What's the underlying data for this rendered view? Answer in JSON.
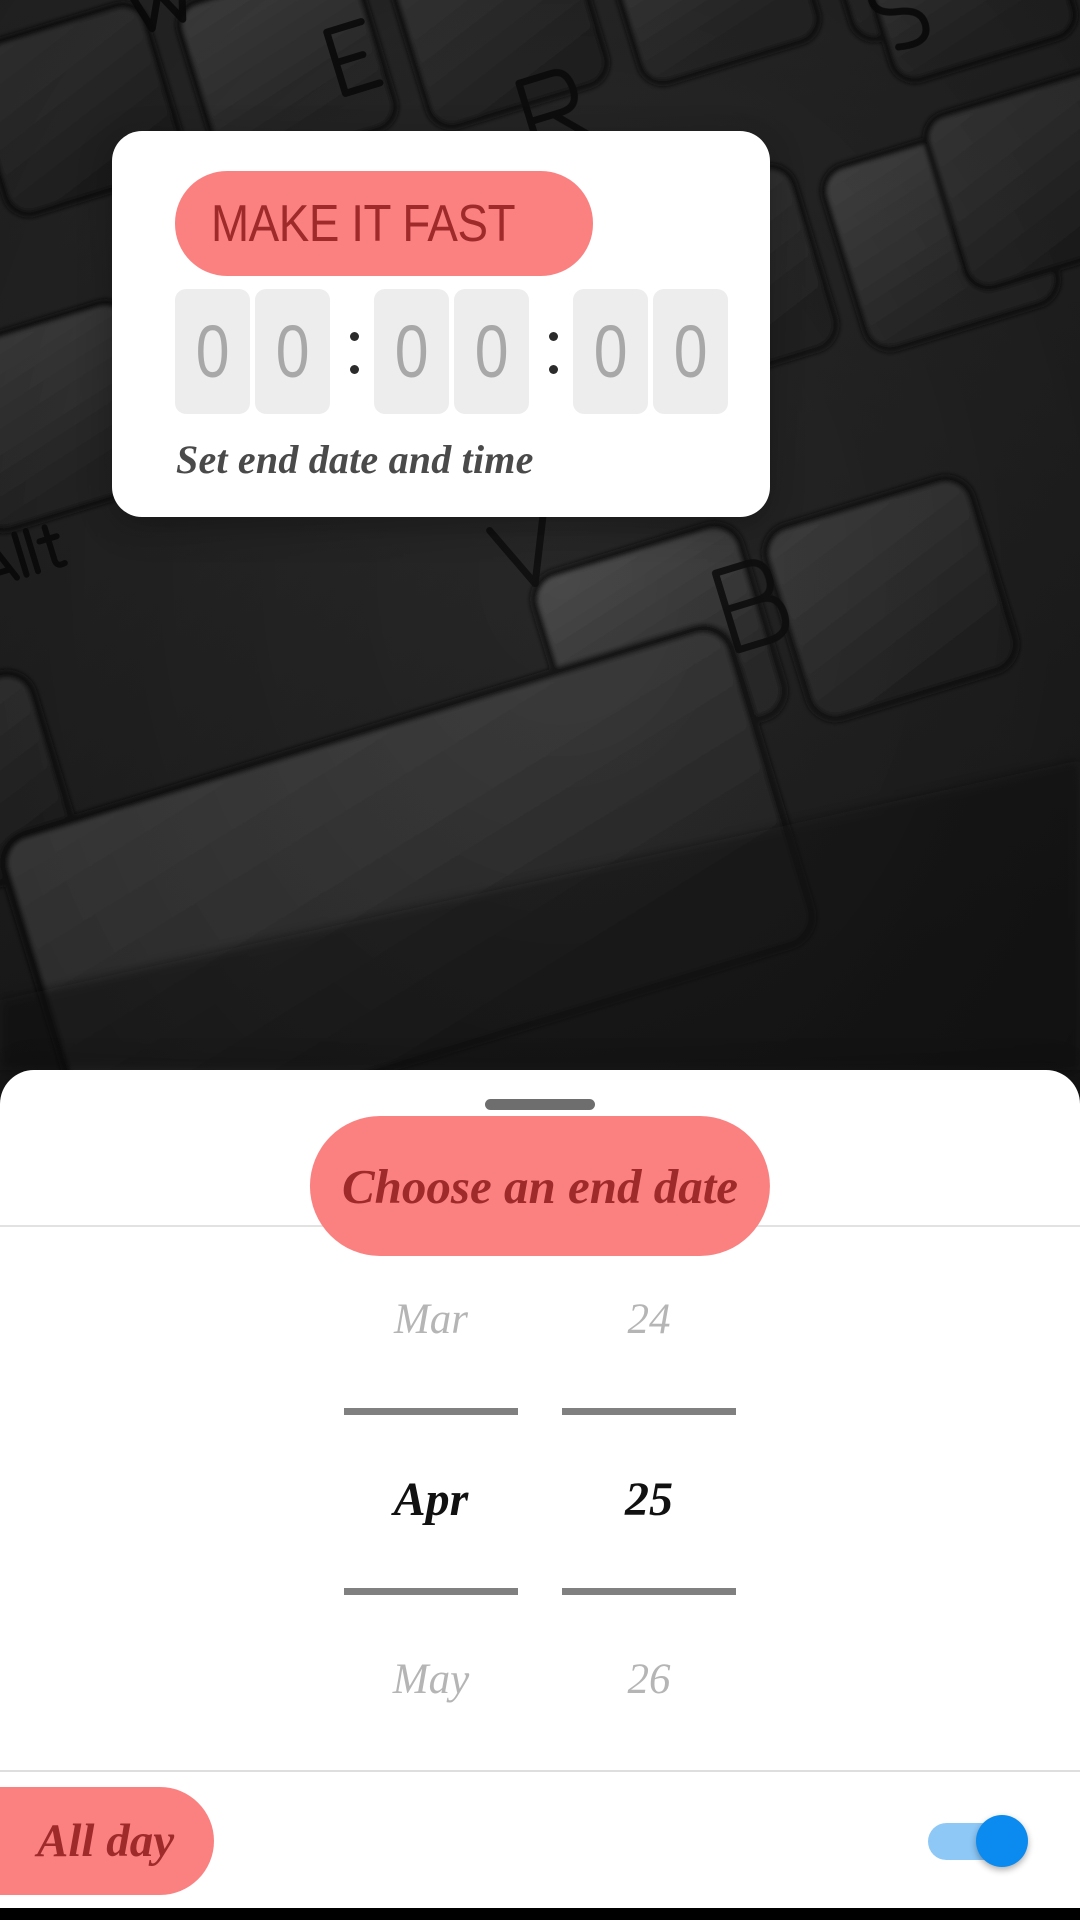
{
  "background": {
    "description": "dark-keyboard-photo",
    "keys": [
      "W",
      "E",
      "R",
      "S",
      "alt",
      "V",
      "B"
    ]
  },
  "widget_card": {
    "title": "MAKE IT FAST",
    "subtitle": "Set end date and time",
    "countdown": {
      "hours": [
        "0",
        "0"
      ],
      "minutes": [
        "0",
        "0"
      ],
      "seconds": [
        "0",
        "0"
      ],
      "separator": ":"
    }
  },
  "bottom_sheet": {
    "title": "Choose an end date",
    "picker": {
      "columns": [
        {
          "name": "month",
          "above": "Mar",
          "selected": "Apr",
          "below": "May"
        },
        {
          "name": "day",
          "above": "24",
          "selected": "25",
          "below": "26"
        }
      ]
    },
    "all_day": {
      "label": "All day",
      "enabled": true
    }
  },
  "colors": {
    "accent": "#FB8181",
    "accent_text": "#9E2A2A",
    "digit_box": "#EDEDED",
    "digit_text": "#A8A8A8",
    "toggle_track": "#8DC8F6",
    "toggle_thumb": "#0B8AF0",
    "sheet_bg": "#FFFFFF"
  }
}
